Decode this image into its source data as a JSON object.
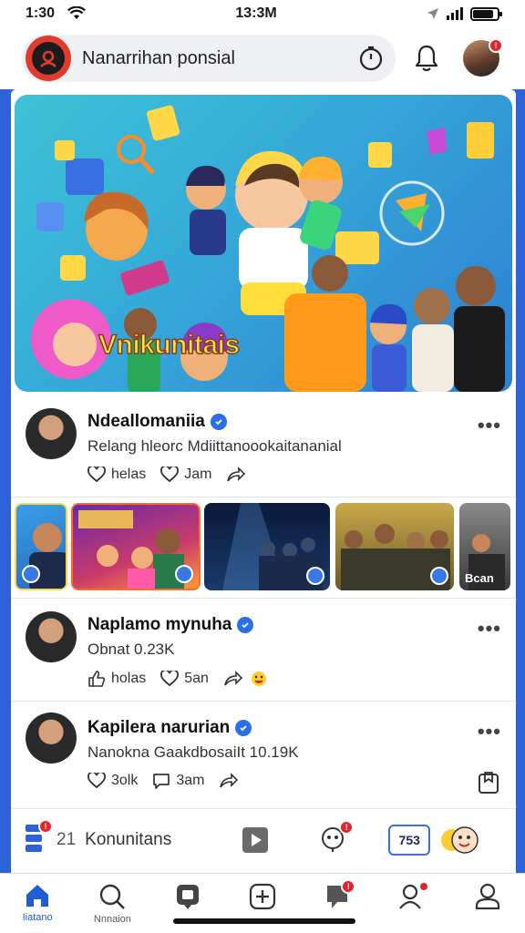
{
  "status_bar": {
    "time_left": "1:30",
    "time_center": "13:3M"
  },
  "header": {
    "search_text": "Nanarrihan ponsial"
  },
  "banner": {
    "title": "Vnikunitais"
  },
  "posts": [
    {
      "name": "Ndeallomaniia",
      "subtitle": "Relang hleorc Mdiittanoookaitananial",
      "actions": [
        "helas",
        "Jam"
      ]
    },
    {
      "name": "Naplamo mynuha",
      "subtitle": "Obnat 0.23K",
      "actions": [
        "holas",
        "5an"
      ]
    },
    {
      "name": "Kapilera narurian",
      "subtitle": "Nanokna GaakdbosaiIt 10.19K",
      "actions": [
        "3olk",
        "3am"
      ]
    }
  ],
  "thumbnails": {
    "last_label": "Bcan"
  },
  "community_bar": {
    "count": "21",
    "label": "Konunitans",
    "counter": "753"
  },
  "bottom_nav": {
    "home_label": "Iiatano",
    "search_label": "Nnnaion"
  },
  "colors": {
    "accent_blue": "#2d63d6",
    "badge_red": "#e3242b",
    "verified_blue": "#2b6fe8"
  }
}
